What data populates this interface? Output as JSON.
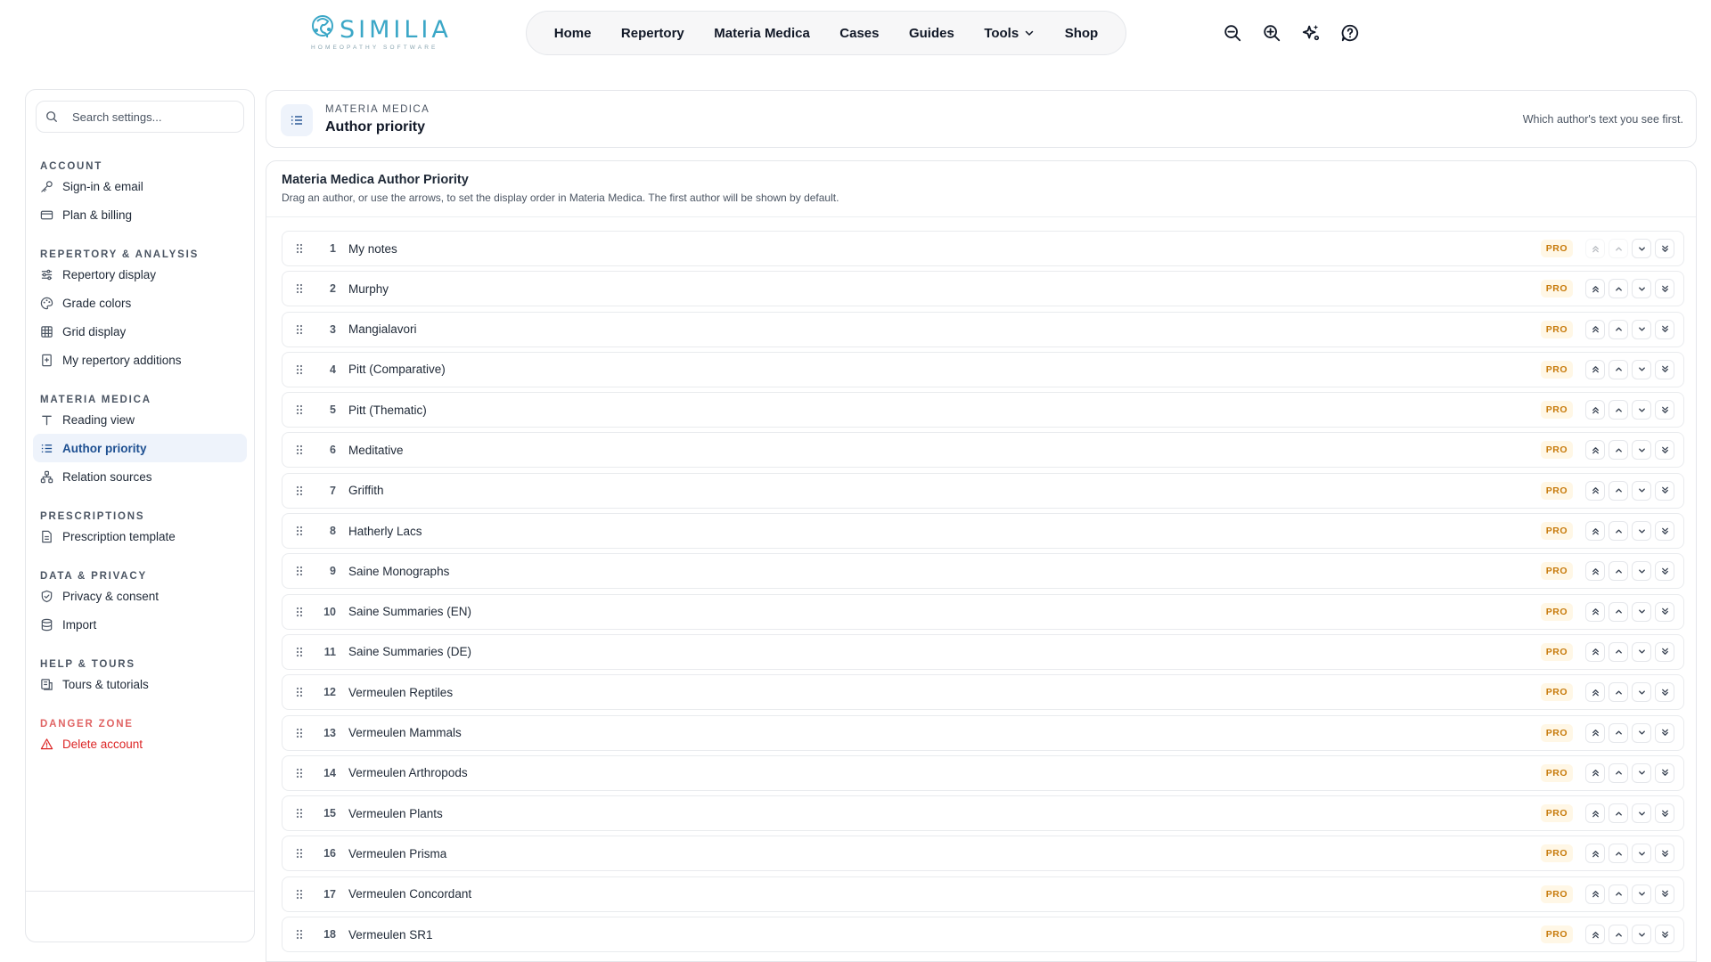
{
  "brand": {
    "name": "SIMILIA",
    "tagline": "HOMEOPATHY SOFTWARE",
    "accent": "#3ba7c7"
  },
  "nav": {
    "home": "Home",
    "repertory": "Repertory",
    "materia_medica": "Materia Medica",
    "cases": "Cases",
    "guides": "Guides",
    "tools": "Tools",
    "shop": "Shop"
  },
  "toolbar_icons": [
    "zoom-out-icon",
    "zoom-in-icon",
    "sparkles-icon",
    "help-icon"
  ],
  "sidebar": {
    "search_placeholder": "Search settings...",
    "sections": {
      "account": {
        "title": "ACCOUNT",
        "items": [
          "Sign-in & email",
          "Plan & billing"
        ]
      },
      "repertory": {
        "title": "REPERTORY & ANALYSIS",
        "items": [
          "Repertory display",
          "Grade colors",
          "Grid display",
          "My repertory additions"
        ]
      },
      "materia": {
        "title": "MATERIA MEDICA",
        "items": [
          "Reading view",
          "Author priority",
          "Relation sources"
        ]
      },
      "prescriptions": {
        "title": "PRESCRIPTIONS",
        "items": [
          "Prescription template"
        ]
      },
      "privacy": {
        "title": "DATA & PRIVACY",
        "items": [
          "Privacy & consent",
          "Import"
        ]
      },
      "help": {
        "title": "HELP & TOURS",
        "items": [
          "Tours & tutorials"
        ]
      },
      "danger": {
        "title": "DANGER ZONE",
        "items": [
          "Delete account"
        ]
      }
    },
    "active_item": "Author priority"
  },
  "header": {
    "kicker": "MATERIA MEDICA",
    "title": "Author priority",
    "description": "Which author's text you see first."
  },
  "list": {
    "title": "Materia Medica Author Priority",
    "description": "Drag an author, or use the arrows, to set the display order in Materia Medica. The first author will be shown by default.",
    "badge": "PRO",
    "authors": [
      {
        "n": "1",
        "name": "My notes"
      },
      {
        "n": "2",
        "name": "Murphy"
      },
      {
        "n": "3",
        "name": "Mangialavori"
      },
      {
        "n": "4",
        "name": "Pitt (Comparative)"
      },
      {
        "n": "5",
        "name": "Pitt (Thematic)"
      },
      {
        "n": "6",
        "name": "Meditative"
      },
      {
        "n": "7",
        "name": "Griffith"
      },
      {
        "n": "8",
        "name": "Hatherly Lacs"
      },
      {
        "n": "9",
        "name": "Saine Monographs"
      },
      {
        "n": "10",
        "name": "Saine Summaries (EN)"
      },
      {
        "n": "11",
        "name": "Saine Summaries (DE)"
      },
      {
        "n": "12",
        "name": "Vermeulen Reptiles"
      },
      {
        "n": "13",
        "name": "Vermeulen Mammals"
      },
      {
        "n": "14",
        "name": "Vermeulen Arthropods"
      },
      {
        "n": "15",
        "name": "Vermeulen Plants"
      },
      {
        "n": "16",
        "name": "Vermeulen Prisma"
      },
      {
        "n": "17",
        "name": "Vermeulen Concordant"
      },
      {
        "n": "18",
        "name": "Vermeulen SR1"
      }
    ]
  }
}
